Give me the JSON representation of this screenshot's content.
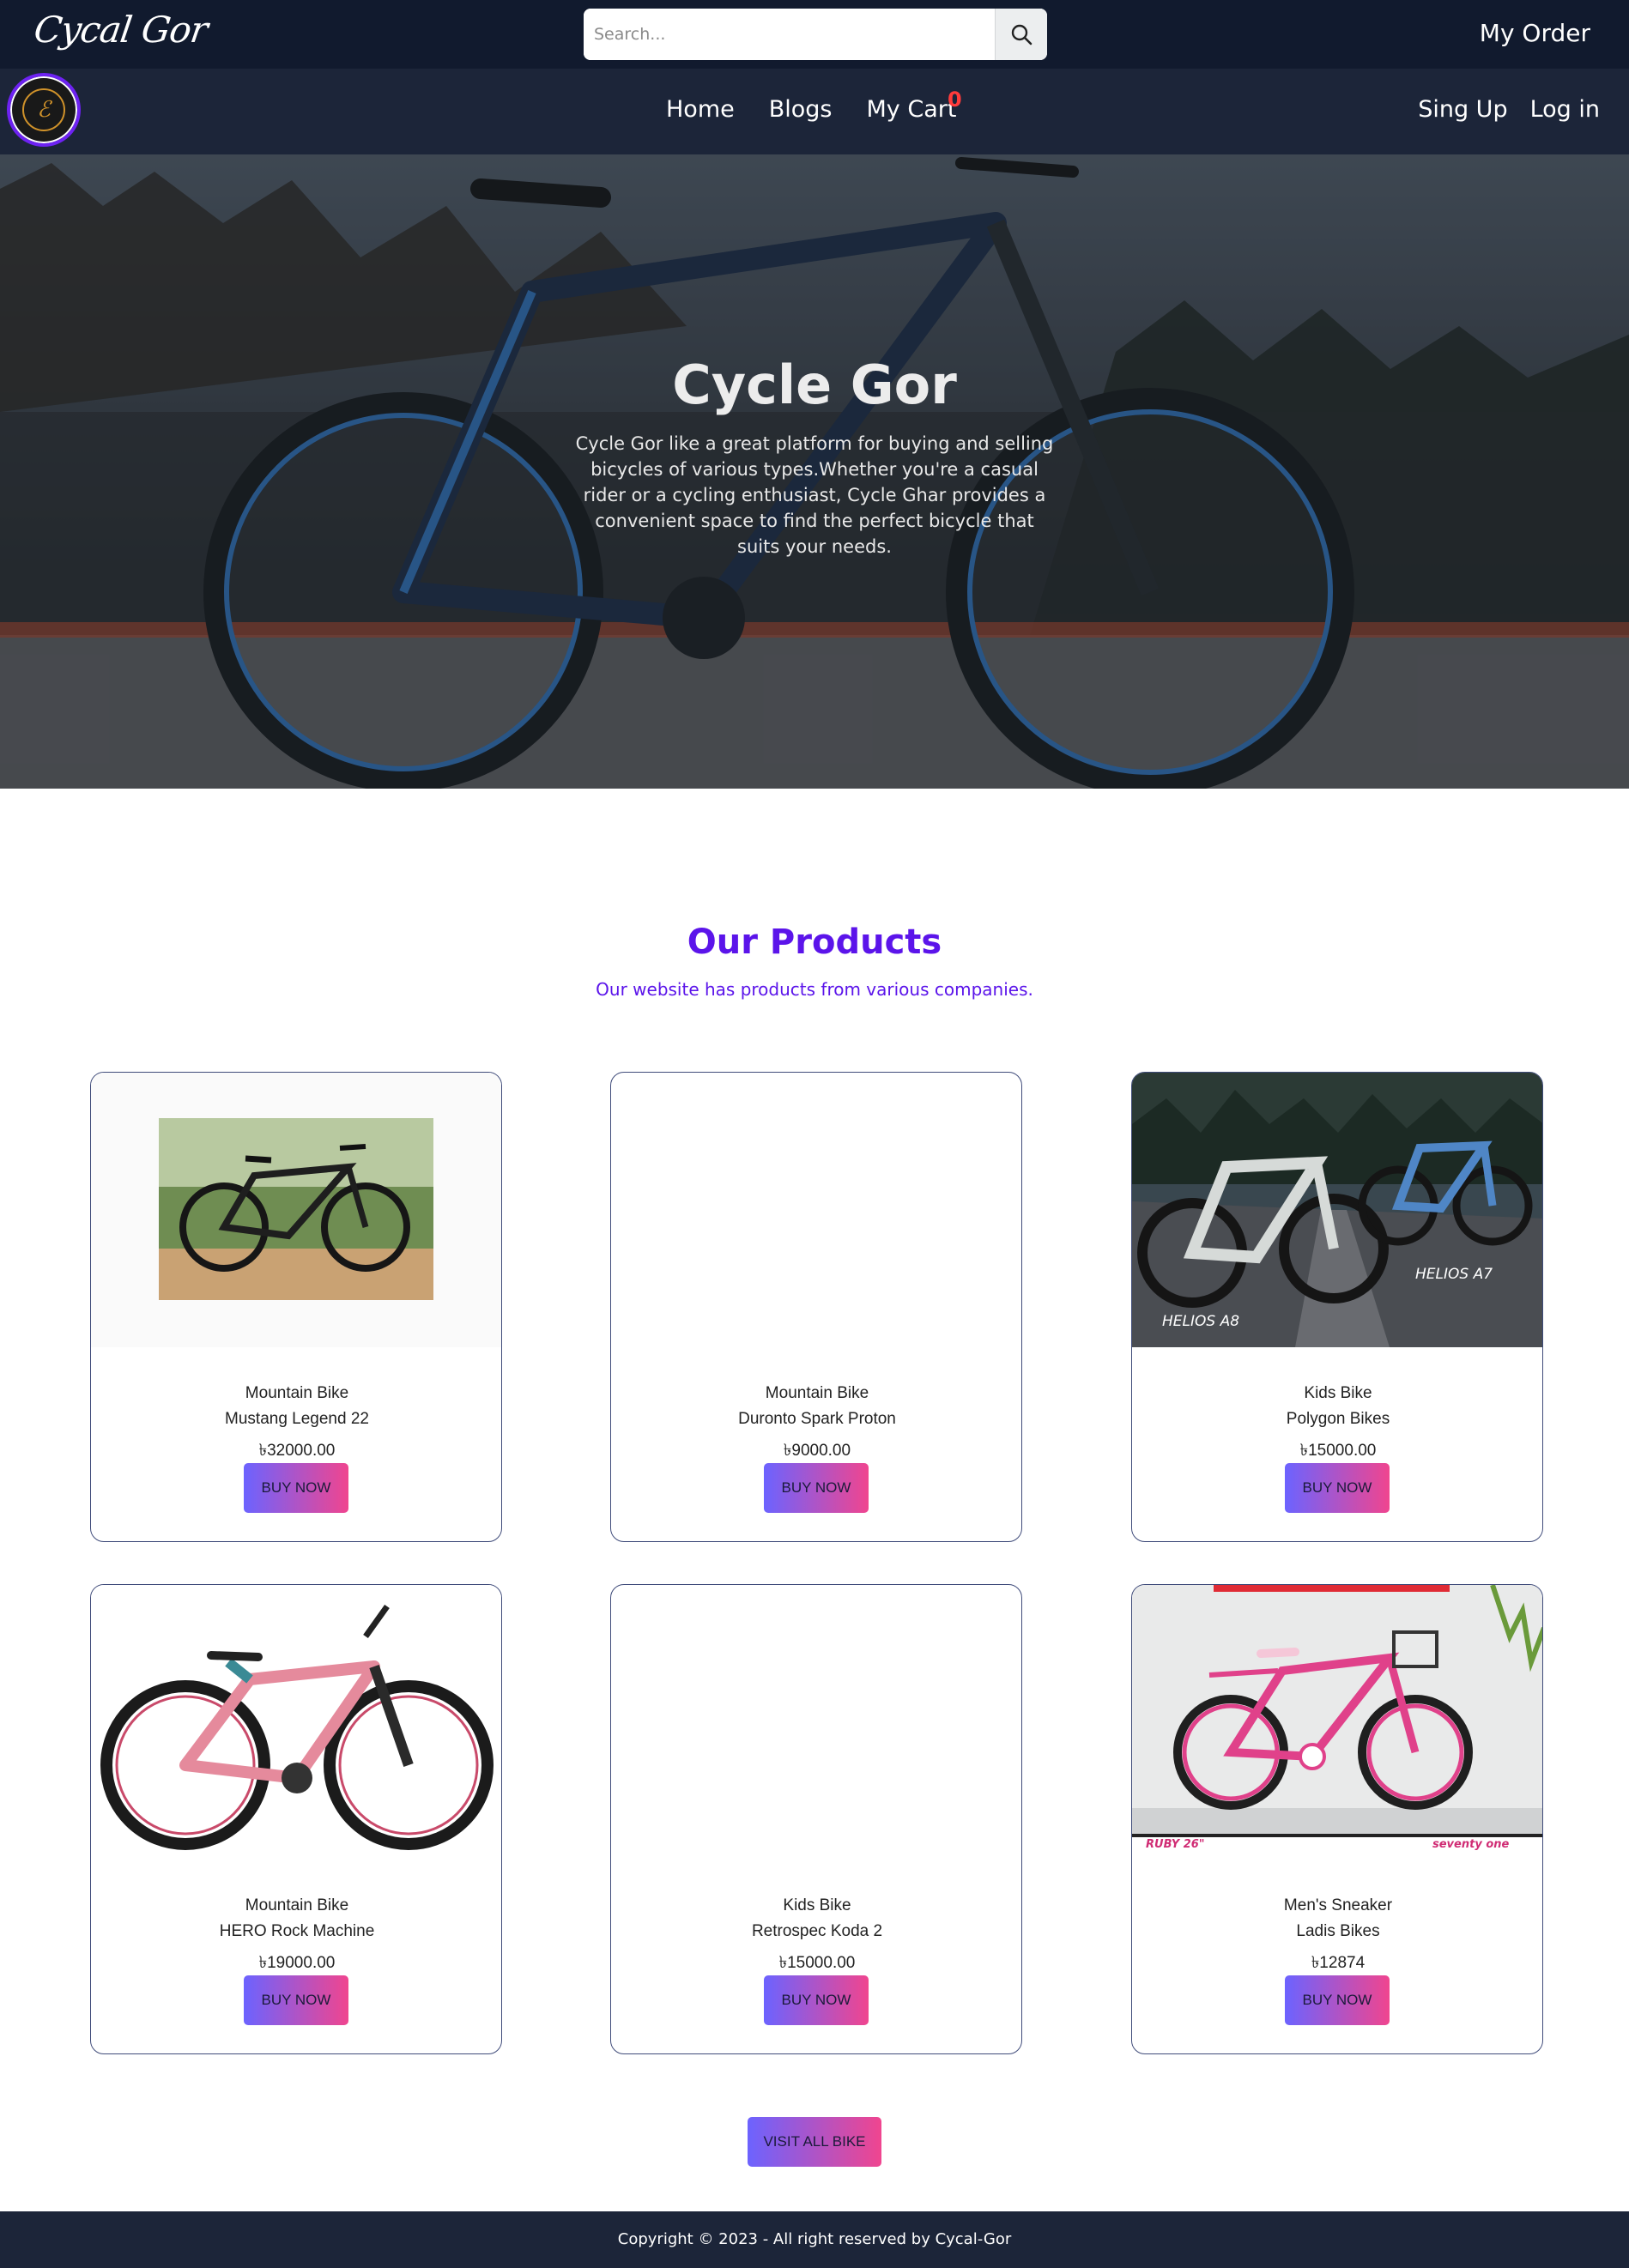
{
  "brand": "Cycal Gor",
  "search": {
    "placeholder": "Search..."
  },
  "top": {
    "my_order": "My Order"
  },
  "nav": {
    "links": [
      "Home",
      "Blogs",
      "My Cart"
    ],
    "cart_count": "0",
    "sign_up": "Sing Up",
    "log_in": "Log in"
  },
  "hero": {
    "title": "Cycle Gor",
    "text": "Cycle Gor like a great platform for buying and selling bicycles of various types.Whether you're a casual rider or a cycling enthusiast, Cycle Ghar provides a convenient space to find the perfect bicycle that suits your needs."
  },
  "products": {
    "title": "Our Products",
    "subtitle": "Our website has products from various companies.",
    "items": [
      {
        "category": "Mountain Bike",
        "name": "Mustang Legend 22",
        "price": "৳32000.00",
        "button": "BUY NOW"
      },
      {
        "category": "Mountain Bike",
        "name": "Duronto Spark Proton",
        "price": "৳9000.00",
        "button": "BUY NOW"
      },
      {
        "category": "Kids Bike",
        "name": "Polygon Bikes",
        "price": "৳15000.00",
        "button": "BUY NOW",
        "image_text": [
          "HELIOS A8",
          "HELIOS A7"
        ]
      },
      {
        "category": "Mountain Bike",
        "name": "HERO Rock Machine",
        "price": "৳19000.00",
        "button": "BUY NOW"
      },
      {
        "category": "Kids Bike",
        "name": "Retrospec Koda 2",
        "price": "৳15000.00",
        "button": "BUY NOW"
      },
      {
        "category": "Men's Sneaker",
        "name": "Ladis Bikes",
        "price": "৳12874",
        "button": "BUY NOW",
        "image_text": [
          "RUBY 26\"",
          "seventy one"
        ]
      }
    ],
    "visit_all": "VISIT ALL BIKE"
  },
  "footer": {
    "copyright": "Copyright © 2023 - All right reserved by Cycal-Gor"
  },
  "colors": {
    "topbar": "#111a2e",
    "navbar": "#1c2539",
    "accent": "#5b14ea",
    "badge": "#ff3b3b",
    "button_start": "#6c63ff",
    "button_end": "#f0458f"
  }
}
